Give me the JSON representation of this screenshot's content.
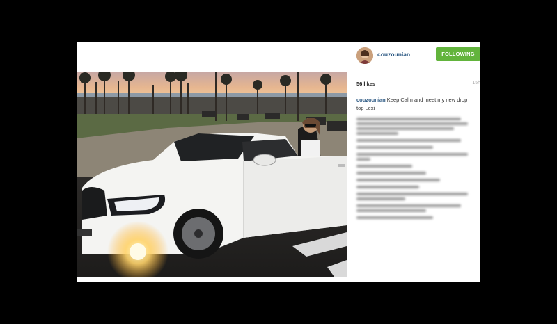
{
  "post": {
    "username": "couzounian",
    "follow_label": "FOLLOWING",
    "likes": "56 likes",
    "time": "15h",
    "caption_user": "couzounian",
    "caption_text": "Keep Calm and meet my new drop top Lexi"
  },
  "colors": {
    "follow_button": "#62b43c",
    "username": "#2f5b85",
    "page_background": "#000000",
    "card_background": "#ffffff"
  },
  "icons": {
    "avatar": "profile-photo"
  }
}
